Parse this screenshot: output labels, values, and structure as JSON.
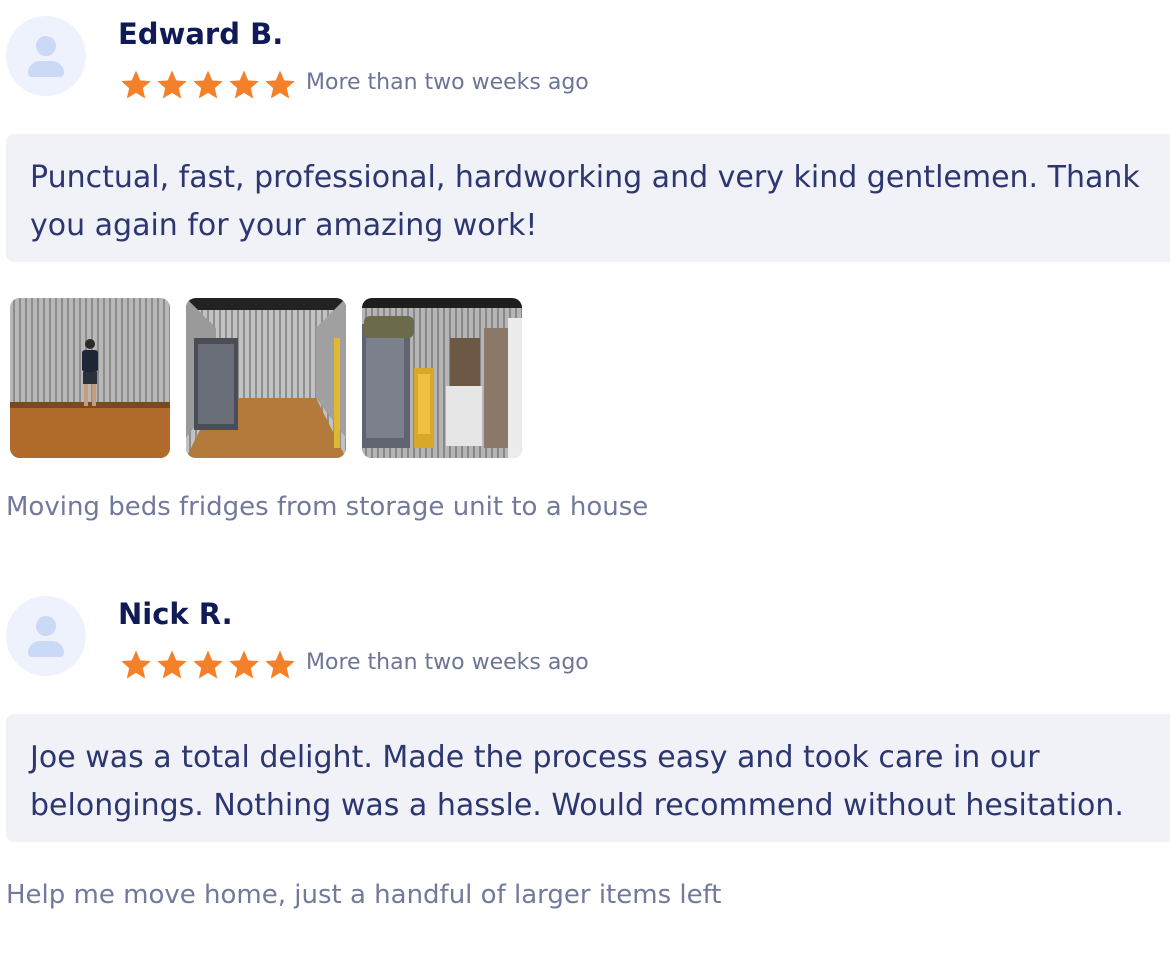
{
  "reviews": [
    {
      "name": "Edward B.",
      "rating": 5,
      "date": "More than two weeks ago",
      "text": "Punctual, fast, professional, hardworking and very kind gentlemen. Thank you again for your amazing work!",
      "photos": [
        "storage-unit-photo-1",
        "storage-unit-photo-2",
        "storage-unit-photo-3"
      ],
      "job": "Moving beds fridges from storage unit to a house"
    },
    {
      "name": "Nick R.",
      "rating": 5,
      "date": "More than two weeks ago",
      "text": "Joe was a total delight. Made the process easy and took care in our belongings. Nothing was a hassle. Would recommend without hesitation.",
      "job": "Help me move home, just a handful of larger items left"
    }
  ],
  "colors": {
    "star": "#f5802a",
    "name": "#0f1a57",
    "bubble_bg": "#f1f2f7",
    "text": "#2c3670",
    "muted": "#6d7597"
  }
}
